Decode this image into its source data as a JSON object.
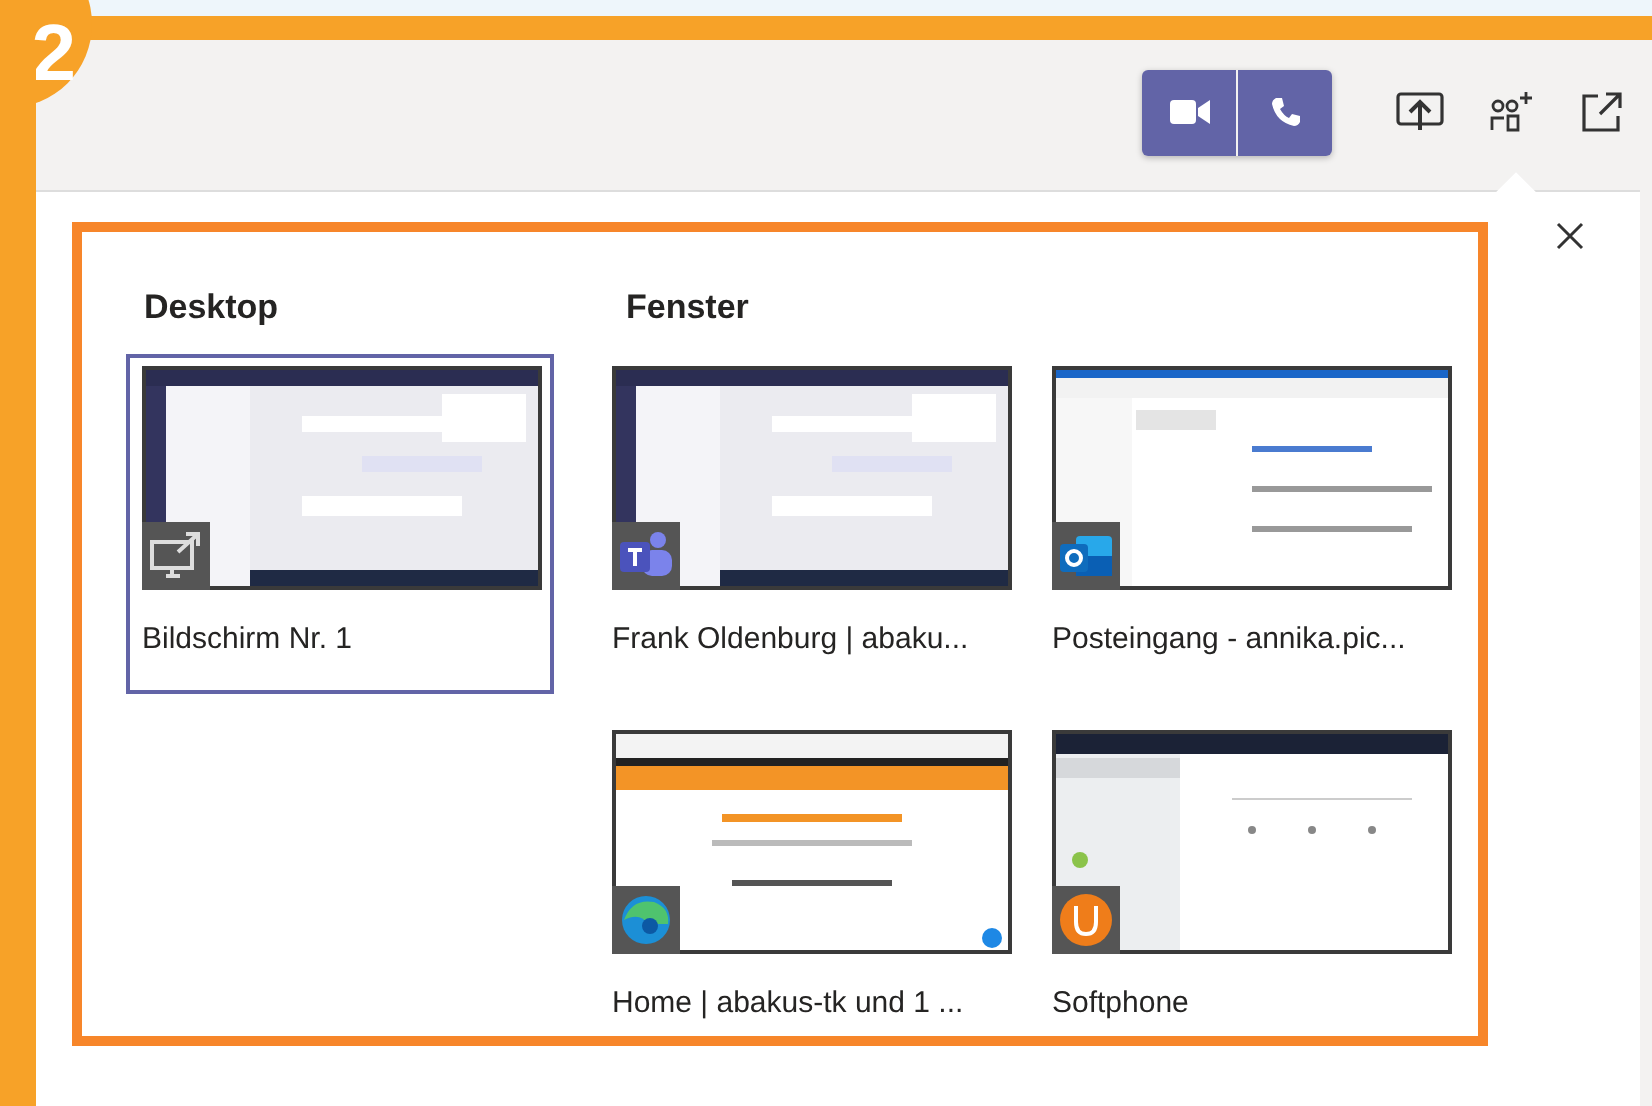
{
  "badge": "2",
  "sections": [
    {
      "title": "Desktop",
      "items": [
        {
          "label": "Bildschirm Nr. 1",
          "kind": "screen",
          "selected": true
        }
      ]
    },
    {
      "title": "Fenster",
      "items": [
        {
          "label": "Frank Oldenburg | abaku...",
          "kind": "teams",
          "selected": false
        },
        {
          "label": "Posteingang - annika.pic...",
          "kind": "outlook",
          "selected": false
        },
        {
          "label": "Home | abakus-tk und 1 ...",
          "kind": "edge",
          "selected": false
        },
        {
          "label": "Softphone",
          "kind": "softphone",
          "selected": false
        }
      ]
    }
  ]
}
